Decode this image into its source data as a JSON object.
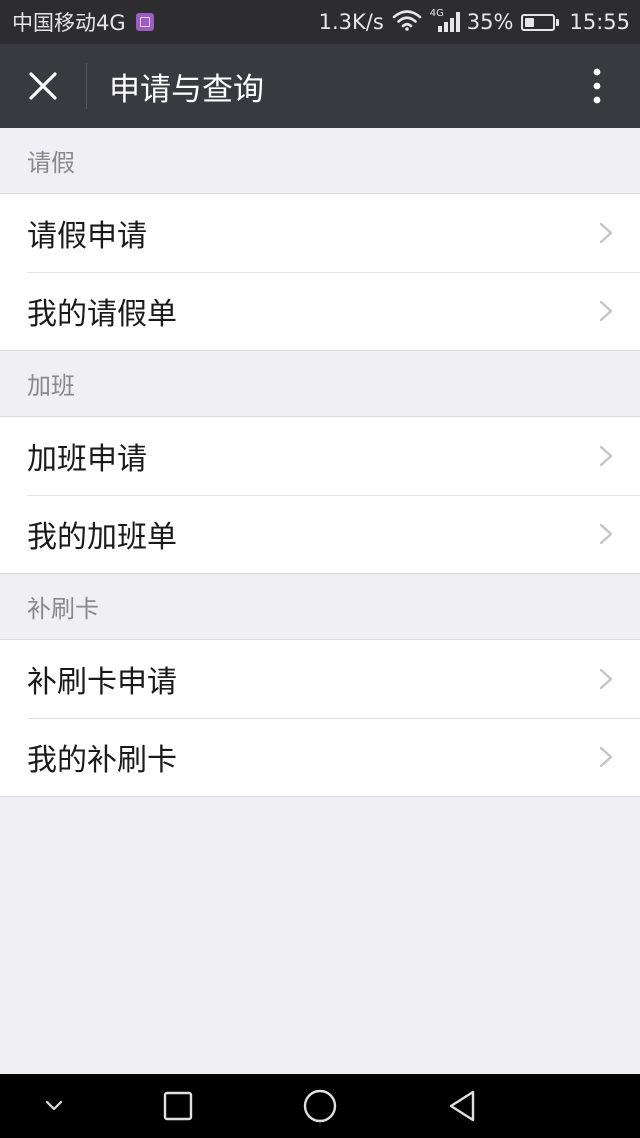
{
  "status_bar": {
    "carrier": "中国移动4G",
    "speed": "1.3K/s",
    "network_type": "4G",
    "battery_percent": "35%",
    "battery_level": 0.35,
    "time": "15:55"
  },
  "nav": {
    "title": "申请与查询"
  },
  "sections": {
    "leave": {
      "header": "请假",
      "items": [
        "请假申请",
        "我的请假单"
      ]
    },
    "overtime": {
      "header": "加班",
      "items": [
        "加班申请",
        "我的加班单"
      ]
    },
    "card": {
      "header": "补刷卡",
      "items": [
        "补刷卡申请",
        "我的补刷卡"
      ]
    }
  },
  "colors": {
    "status_bar_bg": "#2d2d30",
    "nav_bg": "#393a3f",
    "page_bg": "#efeff4",
    "cell_bg": "#ffffff",
    "section_text": "#8a8a8a"
  }
}
